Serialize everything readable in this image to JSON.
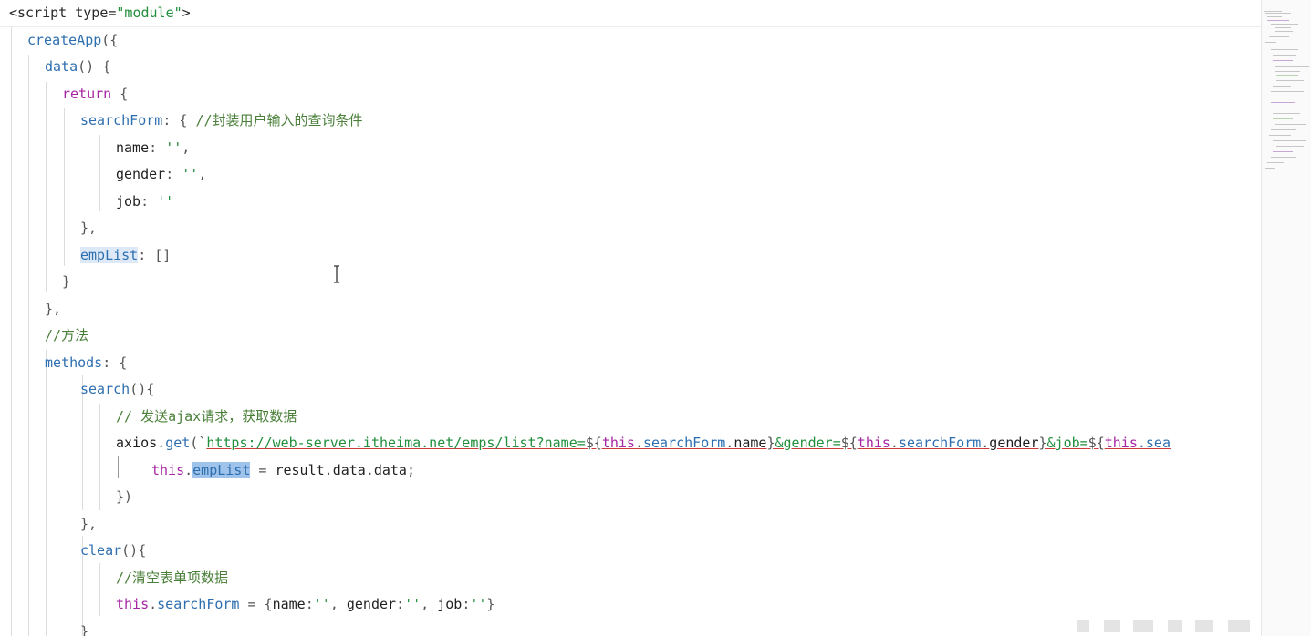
{
  "editor": {
    "lines": [
      [
        {
          "t": "<",
          "c": "tag"
        },
        {
          "t": "script",
          "c": "tag"
        },
        {
          "t": " type=",
          "c": "tag"
        },
        {
          "t": "\"module\"",
          "c": "val"
        },
        {
          "t": ">",
          "c": "tag"
        }
      ],
      [
        {
          "t": "createApp",
          "c": "fn"
        },
        {
          "t": "({",
          "c": "pn"
        }
      ],
      [
        {
          "t": "data",
          "c": "fn"
        },
        {
          "t": "() {",
          "c": "pn"
        }
      ],
      [
        {
          "t": "return",
          "c": "kw"
        },
        {
          "t": " {",
          "c": "pn"
        }
      ],
      [
        {
          "t": "searchForm",
          "c": "fn"
        },
        {
          "t": ": { ",
          "c": "pn"
        },
        {
          "t": "//封装用户输入的查询条件",
          "c": "cm"
        }
      ],
      [
        {
          "t": "name",
          "c": "id"
        },
        {
          "t": ": ",
          "c": "pn"
        },
        {
          "t": "''",
          "c": "str"
        },
        {
          "t": ",",
          "c": "pn"
        }
      ],
      [
        {
          "t": "gender",
          "c": "id"
        },
        {
          "t": ": ",
          "c": "pn"
        },
        {
          "t": "''",
          "c": "str"
        },
        {
          "t": ",",
          "c": "pn"
        }
      ],
      [
        {
          "t": "job",
          "c": "id"
        },
        {
          "t": ": ",
          "c": "pn"
        },
        {
          "t": "''",
          "c": "str"
        }
      ],
      [
        {
          "t": "},",
          "c": "pn"
        }
      ],
      [
        {
          "t": "empList",
          "c": "fn hl-soft"
        },
        {
          "t": ": []",
          "c": "pn"
        }
      ],
      [
        {
          "t": "}",
          "c": "pn"
        }
      ],
      [
        {
          "t": "},",
          "c": "pn"
        }
      ],
      [
        {
          "t": "//方法",
          "c": "cm"
        }
      ],
      [
        {
          "t": "methods",
          "c": "fn"
        },
        {
          "t": ": {",
          "c": "pn"
        }
      ],
      [
        {
          "t": "search",
          "c": "fn"
        },
        {
          "t": "(){",
          "c": "pn"
        }
      ],
      [
        {
          "t": "// 发送ajax请求，获取数据",
          "c": "cm"
        }
      ],
      [
        {
          "t": "axios",
          "c": "id"
        },
        {
          "t": ".",
          "c": "pn"
        },
        {
          "t": "get",
          "c": "fn"
        },
        {
          "t": "(`",
          "c": "pn"
        },
        {
          "t": "https://web-server.itheima.net/emps/list?name=",
          "c": "str url"
        },
        {
          "t": "${",
          "c": "pn url"
        },
        {
          "t": "this",
          "c": "kw url"
        },
        {
          "t": ".",
          "c": "pn url"
        },
        {
          "t": "searchForm",
          "c": "fn url"
        },
        {
          "t": ".",
          "c": "pn url"
        },
        {
          "t": "name",
          "c": "id url"
        },
        {
          "t": "}",
          "c": "pn url"
        },
        {
          "t": "&gender=",
          "c": "str url"
        },
        {
          "t": "${",
          "c": "pn url"
        },
        {
          "t": "this",
          "c": "kw url"
        },
        {
          "t": ".",
          "c": "pn url"
        },
        {
          "t": "searchForm",
          "c": "fn url"
        },
        {
          "t": ".",
          "c": "pn url"
        },
        {
          "t": "gender",
          "c": "id url"
        },
        {
          "t": "}",
          "c": "pn url"
        },
        {
          "t": "&job=",
          "c": "str url"
        },
        {
          "t": "${",
          "c": "pn url"
        },
        {
          "t": "this",
          "c": "kw url"
        },
        {
          "t": ".sea",
          "c": "fn url"
        }
      ],
      [
        {
          "t": "this",
          "c": "kw"
        },
        {
          "t": ".",
          "c": "pn"
        },
        {
          "t": "empList",
          "c": "fn hl-strong"
        },
        {
          "t": " = ",
          "c": "pn"
        },
        {
          "t": "result",
          "c": "id"
        },
        {
          "t": ".",
          "c": "pn"
        },
        {
          "t": "data",
          "c": "id"
        },
        {
          "t": ".",
          "c": "pn"
        },
        {
          "t": "data",
          "c": "id"
        },
        {
          "t": ";",
          "c": "pn"
        }
      ],
      [
        {
          "t": "})",
          "c": "pn"
        }
      ],
      [
        {
          "t": "},",
          "c": "pn"
        }
      ],
      [
        {
          "t": "clear",
          "c": "fn"
        },
        {
          "t": "(){",
          "c": "pn"
        }
      ],
      [
        {
          "t": "//清空表单项数据",
          "c": "cm"
        }
      ],
      [
        {
          "t": "this",
          "c": "kw"
        },
        {
          "t": ".",
          "c": "pn"
        },
        {
          "t": "searchForm",
          "c": "fn"
        },
        {
          "t": " = {",
          "c": "pn"
        },
        {
          "t": "name",
          "c": "id"
        },
        {
          "t": ":",
          "c": "pn"
        },
        {
          "t": "''",
          "c": "str"
        },
        {
          "t": ", ",
          "c": "pn"
        },
        {
          "t": "gender",
          "c": "id"
        },
        {
          "t": ":",
          "c": "pn"
        },
        {
          "t": "''",
          "c": "str"
        },
        {
          "t": ", ",
          "c": "pn"
        },
        {
          "t": "job",
          "c": "id"
        },
        {
          "t": ":",
          "c": "pn"
        },
        {
          "t": "''",
          "c": "str"
        },
        {
          "t": "}",
          "c": "pn"
        }
      ],
      [
        {
          "t": "}",
          "c": "pn"
        }
      ]
    ]
  }
}
